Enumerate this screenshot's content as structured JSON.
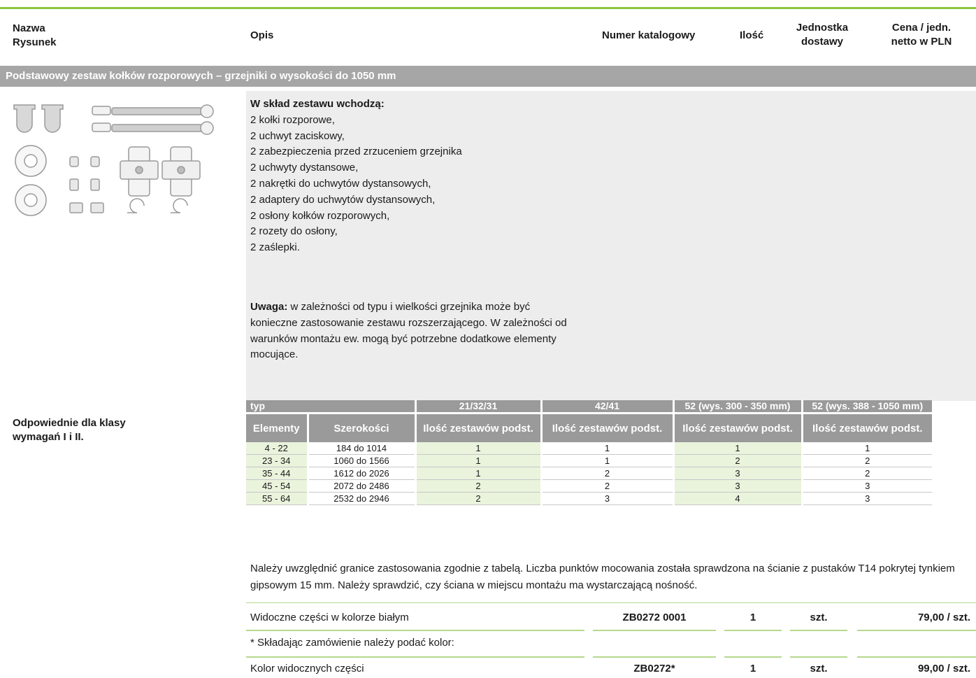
{
  "header": {
    "col1_line1": "Nazwa",
    "col1_line2": "Rysunek",
    "col2": "Opis",
    "col3": "Numer katalogowy",
    "col4": "Ilość",
    "col5_line1": "Jednostka",
    "col5_line2": "dostawy",
    "col6_line1": "Cena / jedn.",
    "col6_line2": "netto w PLN"
  },
  "section_title": "Podstawowy zestaw kołków rozporowych – grzejniki o wysokości do 1050 mm",
  "description": {
    "heading": "W skład zestawu wchodzą:",
    "items": [
      "2 kołki rozporowe,",
      "2 uchwyt zaciskowy,",
      "2 zabezpieczenia przed zrzuceniem grzejnika",
      "2 uchwyty dystansowe,",
      "2 nakrętki do uchwytów dystansowych,",
      "2 adaptery do uchwytów dystansowych,",
      "2 osłony kołków rozporowych,",
      "2 rozety do osłony,",
      "2 zaślepki."
    ],
    "note_label": "Uwaga:",
    "note_text": " w zależności od typu i wielkości grzejnika może być konieczne zastosowanie zestawu rozszerzającego. W zależności od warunków montażu ew. mogą być potrzebne dodatkowe elementy mocujące."
  },
  "suitability": {
    "line1": "Odpowiednie dla klasy",
    "line2": "wymagań I i II."
  },
  "spec_table": {
    "type_label": "typ",
    "type_values": [
      "21/32/31",
      "42/41",
      "52 (wys. 300 - 350 mm)",
      "52 (wys. 388 - 1050 mm)"
    ],
    "col_elements": "Elementy",
    "col_widths": "Szerokości",
    "col_sets": "Ilość zestawów podst.",
    "rows": [
      {
        "elements": "4 - 22",
        "widths": "184 do 1014",
        "v": [
          "1",
          "1",
          "1",
          "1"
        ]
      },
      {
        "elements": "23 - 34",
        "widths": "1060 do 1566",
        "v": [
          "1",
          "1",
          "2",
          "2"
        ]
      },
      {
        "elements": "35 - 44",
        "widths": "1612 do 2026",
        "v": [
          "1",
          "2",
          "3",
          "2"
        ]
      },
      {
        "elements": "45 - 54",
        "widths": "2072 do 2486",
        "v": [
          "2",
          "2",
          "3",
          "3"
        ]
      },
      {
        "elements": "55 - 64",
        "widths": "2532 do 2946",
        "v": [
          "2",
          "3",
          "4",
          "3"
        ]
      }
    ]
  },
  "footnote": "Należy uwzględnić granice zastosowania zgodnie z tabelą. Liczba punktów mocowania została sprawdzona na ścianie z pustaków T14 pokrytej tynkiem gipsowym 15 mm. Należy sprawdzić, czy ściana w miejscu montażu ma wystarczającą nośność.",
  "order_rows": [
    {
      "desc": "Widoczne części w kolorze białym",
      "catalog": "ZB0272 0001",
      "qty": "1",
      "unit": "szt.",
      "price": "79,00 / szt."
    },
    {
      "desc": "* Składając zamówienie należy podać kolor:",
      "catalog": "",
      "qty": "",
      "unit": "",
      "price": ""
    },
    {
      "desc": "Kolor widocznych części",
      "catalog": "ZB0272*",
      "qty": "1",
      "unit": "szt.",
      "price": "99,00 / szt."
    }
  ],
  "colors": {
    "accent_green": "#8cc63f",
    "section_gray": "#a6a6a6",
    "table_header_gray": "#9a9a9a",
    "light_green_cell": "#eaf3dc",
    "body_gray": "#ededed"
  }
}
